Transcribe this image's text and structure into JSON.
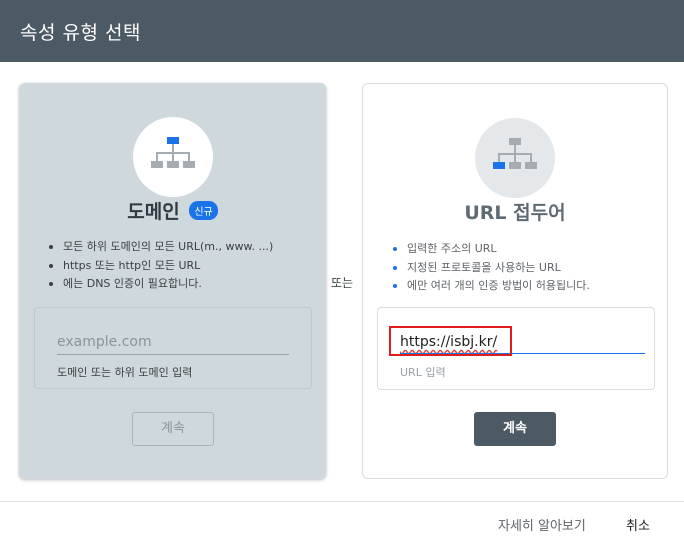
{
  "dialog": {
    "title": "속성 유형 선택"
  },
  "domain_card": {
    "title": "도메인",
    "badge": "신규",
    "bullets": [
      "모든 하위 도메인의 모든 URL(m., www. ...)",
      "https 또는 http인 모든 URL",
      "에는 DNS 인증이 필요합니다."
    ],
    "input_placeholder": "example.com",
    "input_helper": "도메인 또는 하위 도메인 입력",
    "button_label": "계속",
    "icon": "sitemap-icon",
    "highlight_color": "#1a73e8"
  },
  "or_label": "또는",
  "url_card": {
    "title": "URL 접두어",
    "bullets": [
      "입력한 주소의 URL",
      "지정된 프로토콜을 사용하는 URL",
      "에만 여러 개의 인증 방법이 허용됩니다."
    ],
    "input_value": "https://isbj.kr/",
    "input_helper": "URL 입력",
    "button_label": "계속",
    "icon": "sitemap-icon"
  },
  "footer": {
    "learn_more": "자세히 알아보기",
    "cancel": "취소"
  },
  "colors": {
    "header_bg": "#4b5a64",
    "accent": "#1a73e8",
    "annotation_red": "#e21b1b"
  }
}
